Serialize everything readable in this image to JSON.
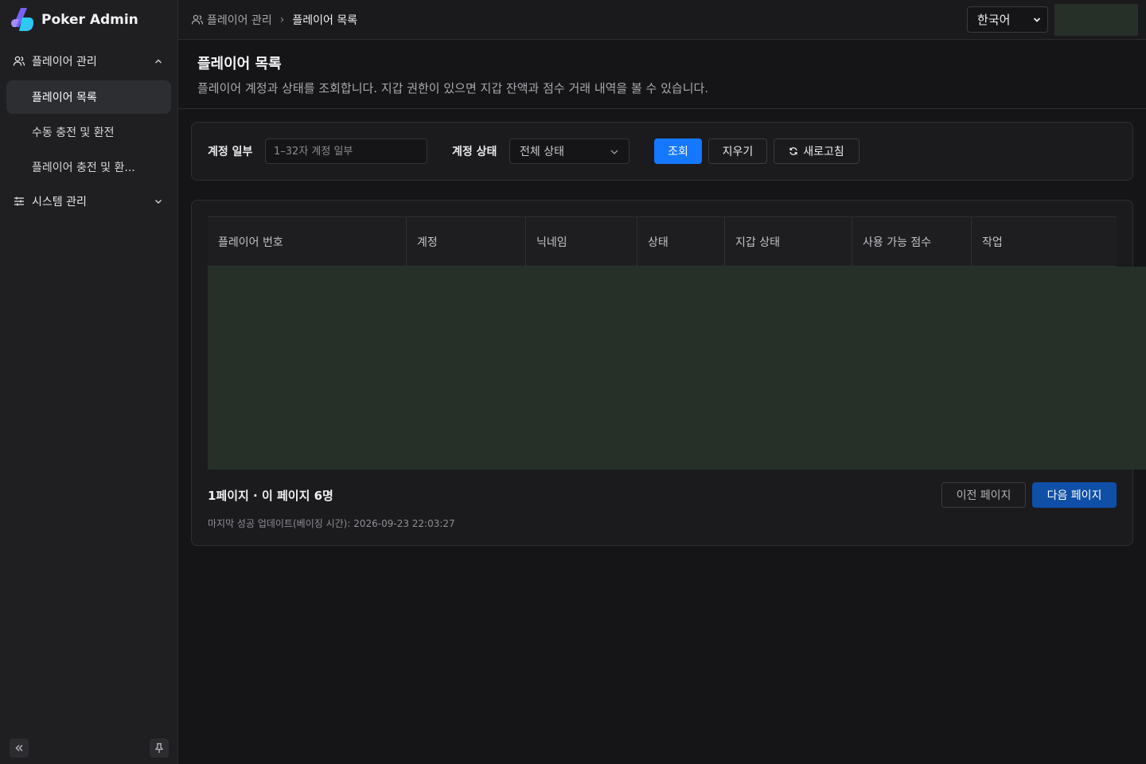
{
  "app": {
    "name": "Poker Admin"
  },
  "sidebar": {
    "groups": [
      {
        "label": "플레이어 관리",
        "icon": "users-icon",
        "expanded": true,
        "items": [
          {
            "label": "플레이어 목록",
            "active": true
          },
          {
            "label": "수동 충전 및 환전",
            "active": false
          },
          {
            "label": "플레이어 충전 및 환...",
            "active": false
          }
        ]
      },
      {
        "label": "시스템 관리",
        "icon": "sliders-icon",
        "expanded": false,
        "items": []
      }
    ],
    "collapse_icon": "double-chevron-left-icon",
    "pin_icon": "pin-icon"
  },
  "header": {
    "breadcrumb": {
      "parent": "플레이어 관리",
      "separator": "›",
      "current": "플레이어 목록"
    },
    "language": "한국어"
  },
  "page": {
    "title": "플레이어 목록",
    "description": "플레이어 계정과 상태를 조회합니다. 지갑 권한이 있으면 지갑 잔액과 점수 거래 내역을 볼 수 있습니다."
  },
  "filters": {
    "account_label": "계정 일부",
    "account_placeholder": "1–32자 계정 일부",
    "account_value": "",
    "status_label": "계정 상태",
    "status_value": "전체 상태",
    "search_label": "조회",
    "clear_label": "지우기",
    "refresh_label": "새로고침"
  },
  "table": {
    "columns": [
      "플레이어 번호",
      "계정",
      "닉네임",
      "상태",
      "지갑 상태",
      "사용 가능 점수",
      "작업"
    ],
    "rows": []
  },
  "pagination": {
    "info": "1페이지 · 이 페이지 6명",
    "updated": "마지막 성공 업데이트(베이징 시간): 2026-09-23 22:03:27",
    "prev_label": "이전 페이지",
    "next_label": "다음 페이지"
  },
  "colors": {
    "accent": "#1677ff",
    "next_button": "#0f4fa8",
    "background": "#151517",
    "sidebar": "#1f1f22"
  }
}
